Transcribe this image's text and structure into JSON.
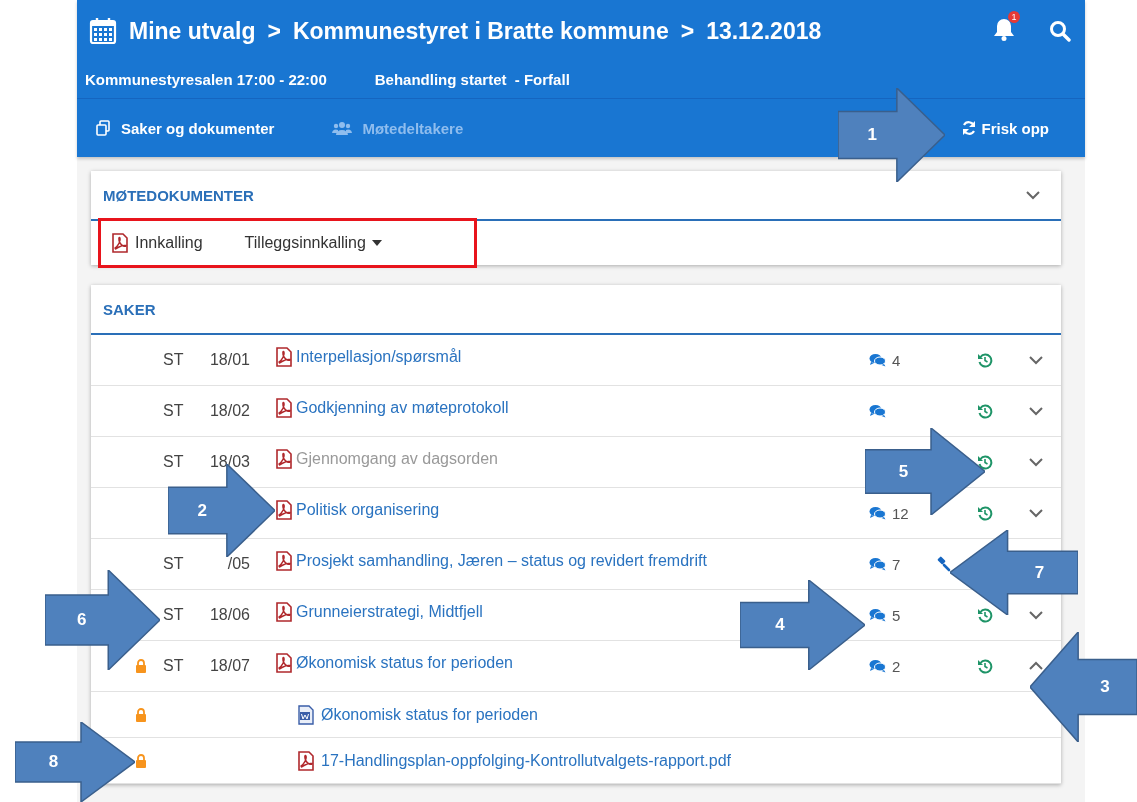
{
  "header": {
    "title_parts": [
      "Mine utvalg",
      ">",
      "Kommunestyret i Bratte kommune",
      ">",
      "13.12.2018"
    ],
    "notification_count": "1",
    "info": [
      "Kommunestyresalen 17:00 - 22:00",
      "Behandling startet  - Forfall"
    ],
    "tabs": [
      {
        "label": "Saker og dokumenter",
        "disabled": false,
        "kind": "documents"
      },
      {
        "label": "Møtedeltakere",
        "disabled": true,
        "kind": "people"
      }
    ],
    "refresh": "Frisk opp"
  },
  "meeting_documents": {
    "title": "MØTEDOKUMENTER",
    "highlighted": true,
    "documents": [
      {
        "label": "Innkalling",
        "kind": "pdf"
      },
      {
        "label": "Tilleggsinnkalling",
        "kind": "dropdown"
      }
    ]
  },
  "cases": {
    "title": "SAKER",
    "rows": [
      {
        "type": "ST",
        "number": "18/01",
        "title": "Interpellasjon/spørsmål",
        "locked": false,
        "disabled": false,
        "comments": true,
        "comment_count": "4",
        "history": true,
        "expanded": false
      },
      {
        "type": "ST",
        "number": "18/02",
        "title": "Godkjenning av møteprotokoll",
        "locked": false,
        "disabled": false,
        "comments": true,
        "history": true,
        "expanded": false
      },
      {
        "type": "ST",
        "number": "18/03",
        "title": "Gjennomgang av dagsorden",
        "locked": false,
        "disabled": true,
        "comments": false,
        "history": true,
        "expanded": false
      },
      {
        "title": "Politisk organisering",
        "locked": false,
        "disabled": false,
        "comments": true,
        "comment_count": "12",
        "history": true,
        "expanded": false
      },
      {
        "type": "ST",
        "number": "/05",
        "title": "Prosjekt samhandling, Jæren – status og revidert fremdrift",
        "locked": false,
        "disabled": false,
        "comments": true,
        "comment_count": "7",
        "gavel": true
      },
      {
        "type": "ST",
        "number": "18/06",
        "title": "Grunneierstrategi, Midtfjell",
        "locked": false,
        "disabled": false,
        "comments": true,
        "comment_count": "5",
        "history": true,
        "expanded": false
      },
      {
        "type": "ST",
        "number": "18/07",
        "title": "Økonomisk status for perioden",
        "locked": true,
        "disabled": false,
        "comments": true,
        "comment_count": "2",
        "history": true,
        "expanded": true,
        "children": [
          {
            "kind": "word",
            "title": "Økonomisk status for perioden",
            "locked": true
          },
          {
            "kind": "pdf",
            "title": "17-Handlingsplan-oppfolging-Kontrollutvalgets-rapport.pdf",
            "locked": true
          }
        ]
      }
    ]
  },
  "callouts": [
    {
      "label": "1",
      "kind": "right"
    },
    {
      "label": "2",
      "kind": "right"
    },
    {
      "label": "3",
      "kind": "left"
    },
    {
      "label": "4",
      "kind": "right"
    },
    {
      "label": "5",
      "kind": "right"
    },
    {
      "label": "6",
      "kind": "right"
    },
    {
      "label": "7",
      "kind": "left"
    },
    {
      "label": "8",
      "kind": "right"
    }
  ]
}
